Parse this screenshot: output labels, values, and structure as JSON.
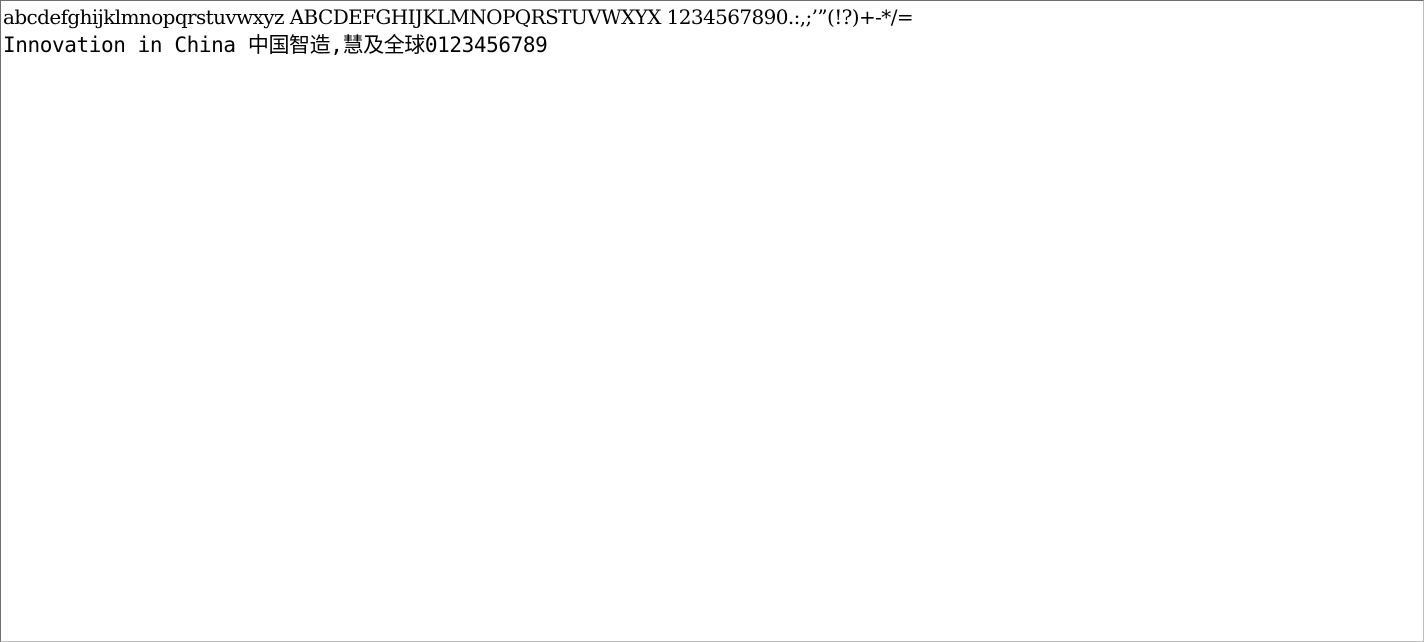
{
  "window": {
    "text_lines": [
      "abcdefghijklmnopqrstuvwxyz ABCDEFGHIJKLMNOPQRSTUVWXYX 1234567890.:,;’”(!?)+-*/=",
      "Innovation in China 中国智造,慧及全球0123456789"
    ]
  },
  "colors": {
    "background": "#ffffff",
    "text": "#000000",
    "border_dark": "#6e6e6e",
    "border_light": "#bdbdbd"
  }
}
